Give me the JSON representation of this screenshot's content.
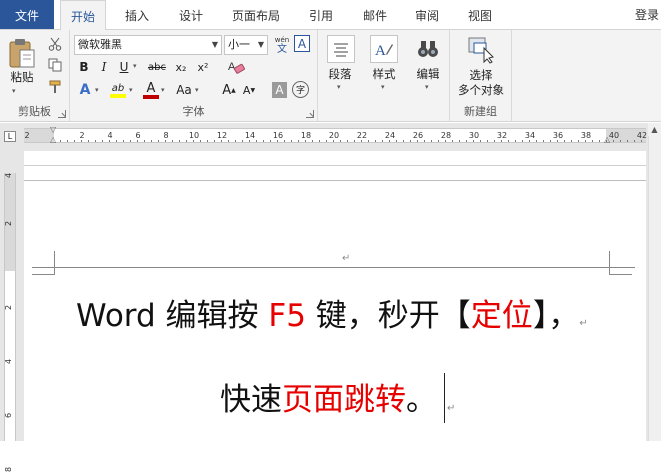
{
  "tabs": {
    "file": "文件",
    "home": "开始",
    "insert": "插入",
    "design": "设计",
    "layout": "页面布局",
    "references": "引用",
    "mailings": "邮件",
    "review": "审阅",
    "view": "视图",
    "login": "登录"
  },
  "clipboard": {
    "paste_label": "粘贴",
    "group_label": "剪贴板"
  },
  "font": {
    "font_name": "微软雅黑",
    "font_size": "小一",
    "wen_label": "wén",
    "wen_char": "文",
    "A_box": "A",
    "bold": "B",
    "italic": "I",
    "underline": "U",
    "strike": "abc",
    "subscript": "x₂",
    "superscript": "x²",
    "text_effect": "A",
    "highlight": "ab",
    "font_color": "A",
    "change_case": "Aa",
    "grow": "A",
    "shrink": "A",
    "char_shading": "A",
    "enclose": "字",
    "group_label": "字体",
    "accent_red": "#c00000",
    "highlight_yellow": "#ffff00"
  },
  "paragraph": {
    "label": "段落"
  },
  "styles": {
    "label": "样式"
  },
  "editing": {
    "label": "编辑"
  },
  "select": {
    "line1": "选择",
    "line2": "多个对象",
    "group_label": "新建组"
  },
  "ruler": {
    "ticks": [
      "2",
      "2",
      "4",
      "6",
      "8",
      "10",
      "12",
      "14",
      "16",
      "18",
      "20",
      "22",
      "24",
      "26",
      "28",
      "30",
      "32",
      "34",
      "36",
      "38",
      "40",
      "42"
    ],
    "vticks": [
      "4",
      "2",
      "2",
      "4",
      "6",
      "8"
    ]
  },
  "document": {
    "line1_a": "Word 编辑按 ",
    "line1_b": "F5",
    "line1_c": " 键，秒开【",
    "line1_d": "定位",
    "line1_e": "】，",
    "line2_a": "快速",
    "line2_b": "页面跳转",
    "line2_c": "。",
    "para_mark": "↵",
    "accent_red": "#e60000"
  }
}
